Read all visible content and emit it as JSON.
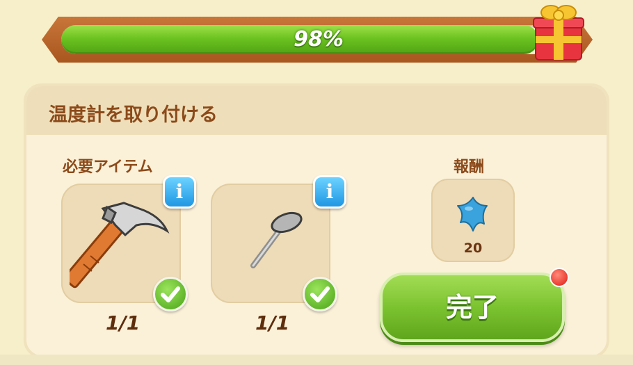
{
  "progress": {
    "percent_label": "98%",
    "fraction": 0.98
  },
  "quest": {
    "title": "温度計を取り付ける"
  },
  "requirements": {
    "label": "必要アイテム",
    "items": [
      {
        "icon": "hammer-icon",
        "count": "1/1",
        "done": true
      },
      {
        "icon": "nail-icon",
        "count": "1/1",
        "done": true
      }
    ]
  },
  "reward": {
    "label": "報酬",
    "icon": "blue-star-icon",
    "amount": "20"
  },
  "actions": {
    "complete_label": "完了"
  },
  "colors": {
    "title_brown": "#8c4a1a",
    "progress_green": "#6cc321",
    "info_blue": "#1f97e3",
    "check_green": "#4aa317",
    "reward_blue": "#3aa2dc"
  }
}
